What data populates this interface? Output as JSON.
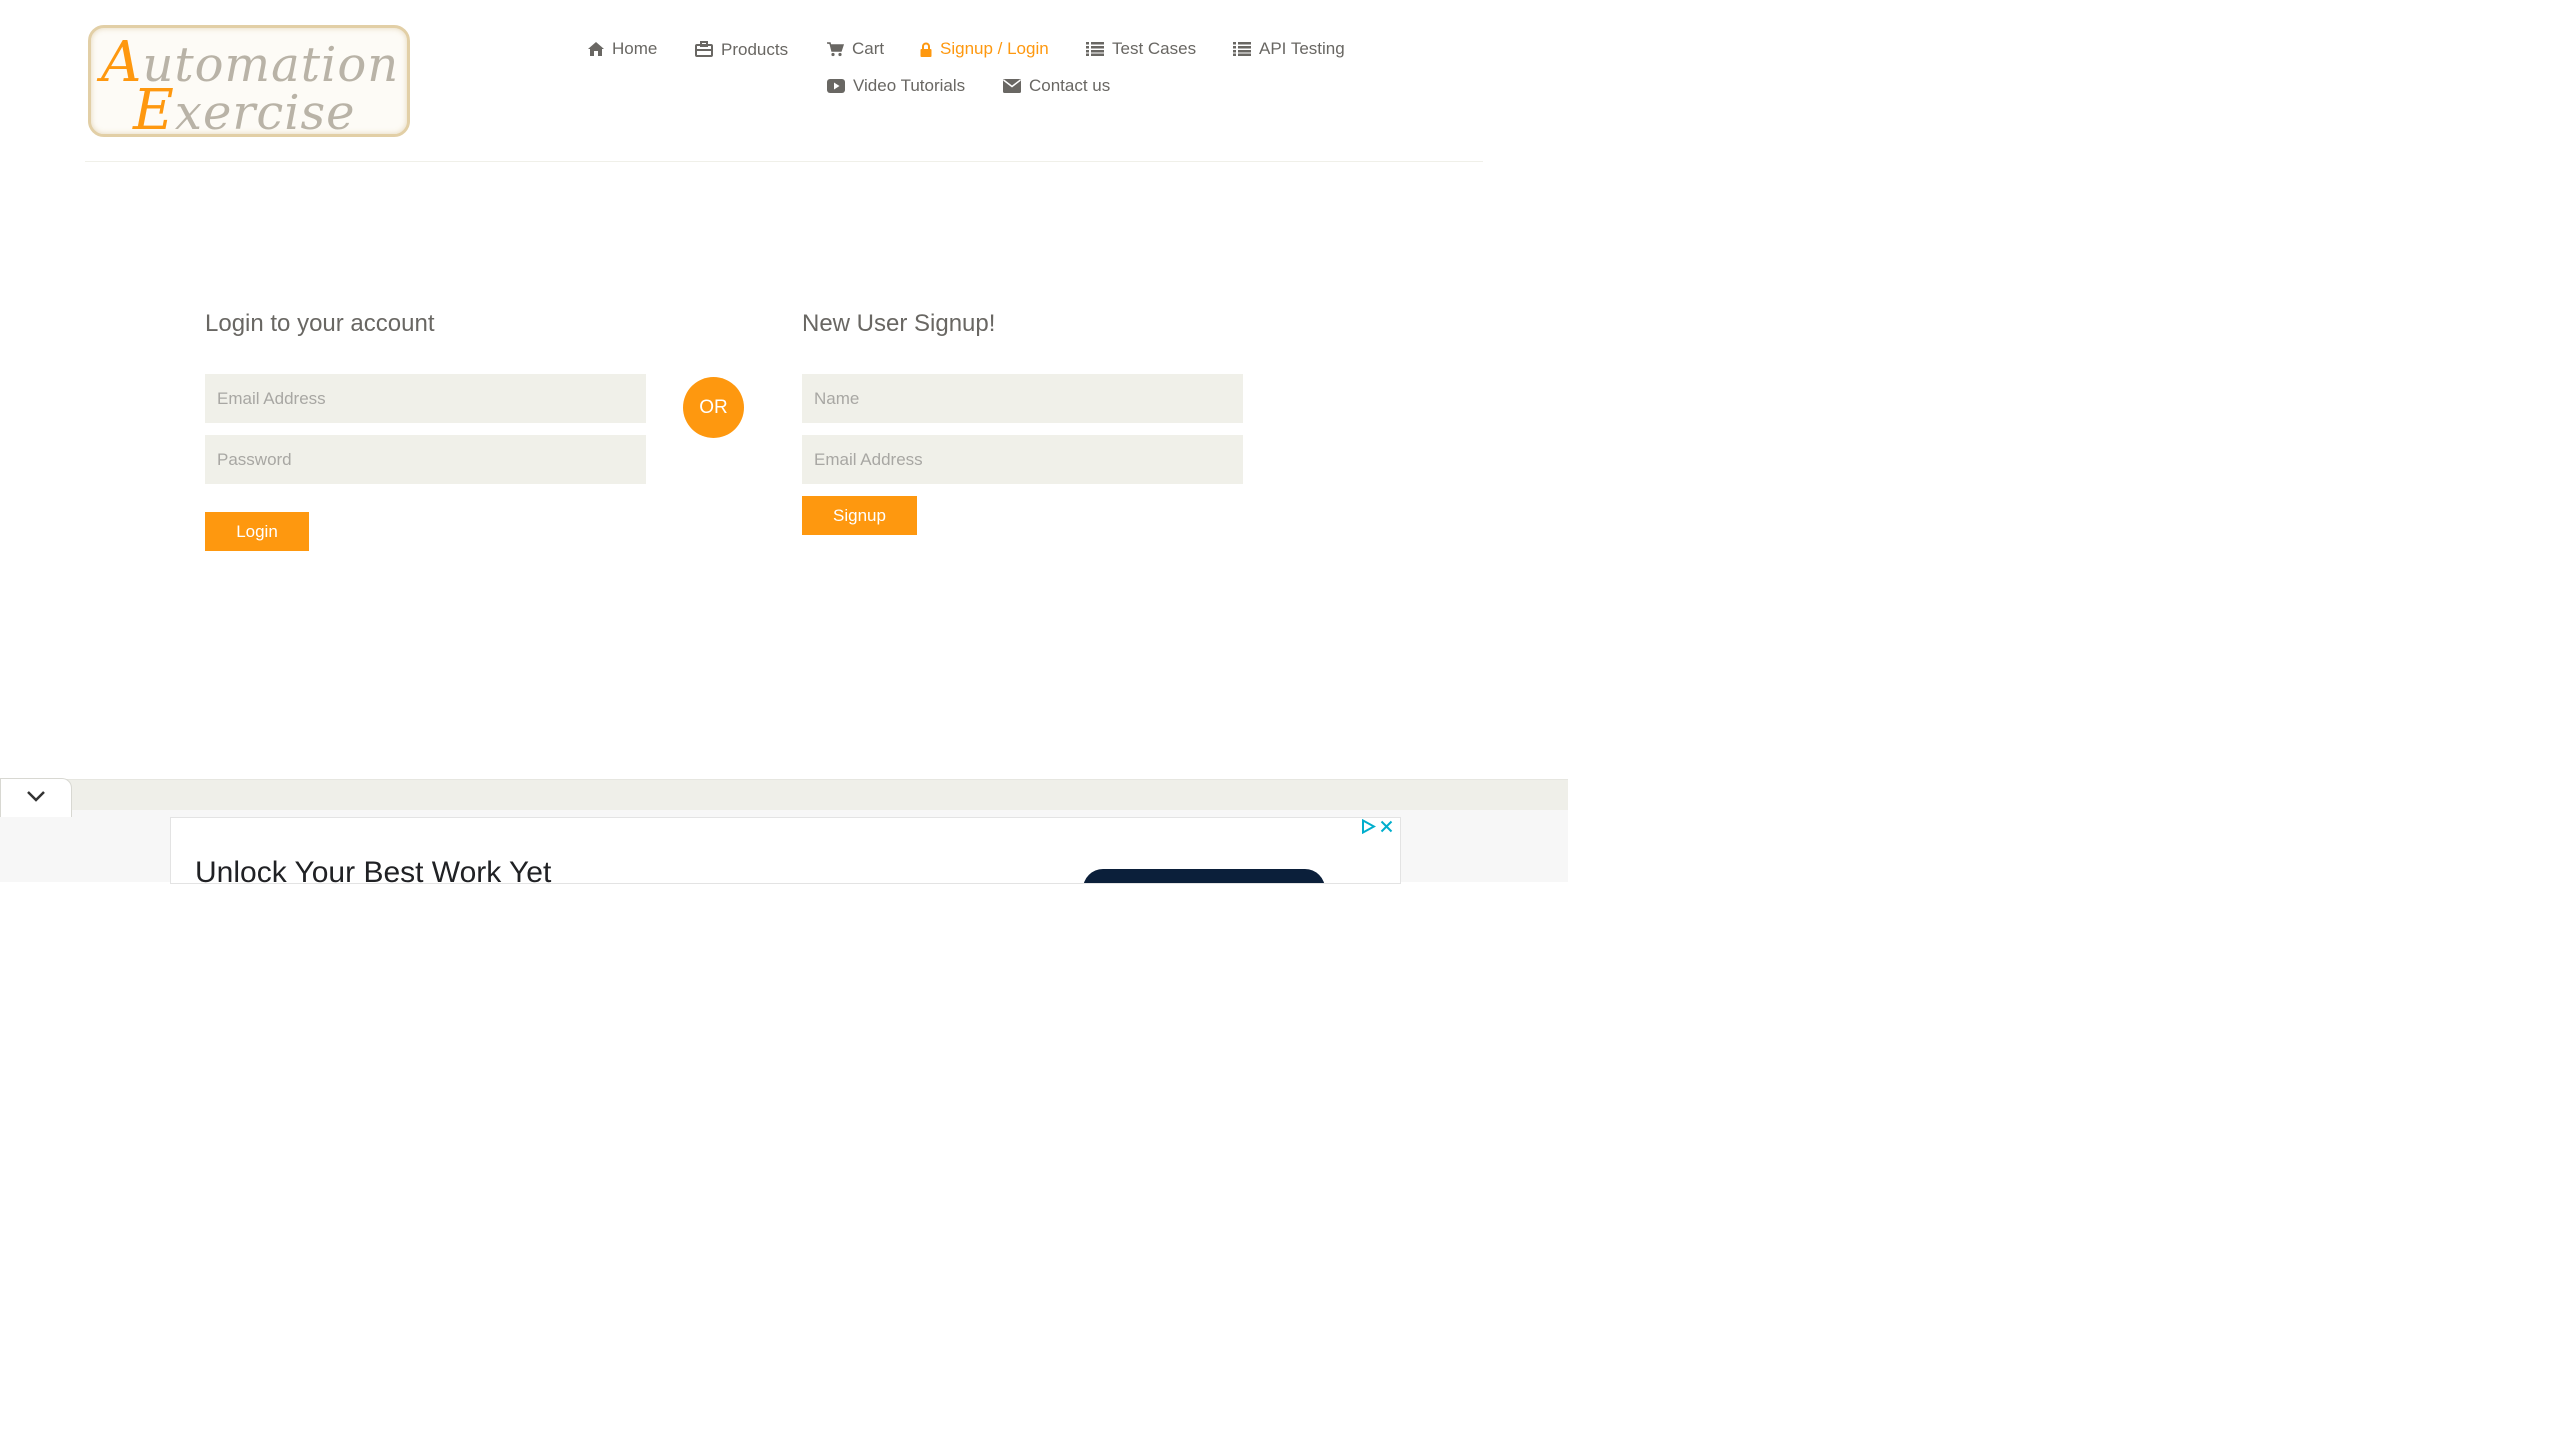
{
  "logo": {
    "line1_first": "A",
    "line1_rest": "utomation",
    "line2_first": "E",
    "line2_rest": "xercise"
  },
  "nav": {
    "home": "Home",
    "products": "Products",
    "cart": "Cart",
    "signup_login": "Signup / Login",
    "test_cases": "Test Cases",
    "api_testing": "API Testing",
    "video_tutorials": "Video Tutorials",
    "contact_us": "Contact us"
  },
  "login": {
    "title": "Login to your account",
    "email_placeholder": "Email Address",
    "password_placeholder": "Password",
    "button": "Login"
  },
  "or_label": "OR",
  "signup": {
    "title": "New User Signup!",
    "name_placeholder": "Name",
    "email_placeholder": "Email Address",
    "button": "Signup"
  },
  "ad": {
    "headline": "Unlock Your Best Work Yet"
  },
  "colors": {
    "accent": "#fe980f",
    "input_bg": "#f0f0e9",
    "text": "#696763"
  },
  "icons": [
    "home-icon",
    "briefcase-icon",
    "cart-icon",
    "lock-icon",
    "list-icon",
    "youtube-play-icon",
    "envelope-icon",
    "chevron-down-icon",
    "ad-choices-icon",
    "close-icon"
  ]
}
